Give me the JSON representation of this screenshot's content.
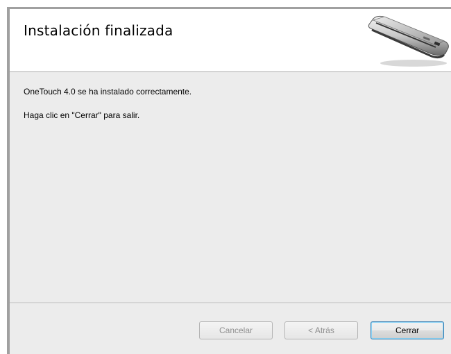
{
  "header": {
    "title": "Instalación finalizada",
    "image_icon": "scanner-device-icon"
  },
  "body": {
    "line1": "OneTouch 4.0 se ha instalado correctamente.",
    "line2": "Haga clic en \"Cerrar\" para salir."
  },
  "buttons": {
    "cancel": "Cancelar",
    "back": "< Atrás",
    "close": "Cerrar"
  },
  "colors": {
    "dialog_background": "#ececec",
    "header_background": "#ffffff",
    "default_button_border": "#3c7fb1",
    "disabled_text": "#8f8f8f"
  }
}
